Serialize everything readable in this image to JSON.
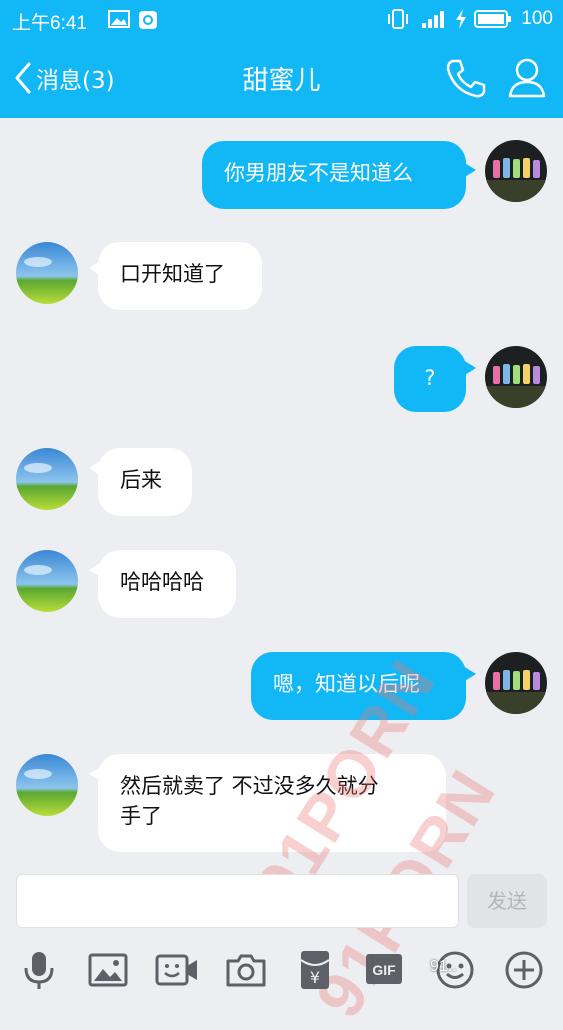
{
  "status_bar": {
    "time": "上午6:41",
    "battery": "100"
  },
  "header": {
    "back_label": "消息(3)",
    "title": "甜蜜儿"
  },
  "messages": [
    {
      "side": "out",
      "text": "你男朋友不是知道么"
    },
    {
      "side": "in",
      "text": "口开知道了"
    },
    {
      "side": "out",
      "text": "?"
    },
    {
      "side": "in",
      "text": "后来"
    },
    {
      "side": "in",
      "text": "哈哈哈哈"
    },
    {
      "side": "out",
      "text": "嗯，知道以后呢"
    },
    {
      "side": "in",
      "text": "然后就卖了 不过没多久就分\n手了"
    }
  ],
  "input": {
    "value": "",
    "send_label": "发送"
  },
  "toolbar": {
    "items": [
      "microphone-icon",
      "image-icon",
      "video-call-icon",
      "camera-icon",
      "red-packet-icon",
      "gif-icon",
      "emoji-icon",
      "plus-icon"
    ],
    "gif_label": "GIF",
    "yen_label": "¥"
  },
  "watermark": {
    "text_1": "91PORN",
    "text_2": "91PORN",
    "site": "91.."
  },
  "colors": {
    "accent": "#12b7f5",
    "background": "#edeef2",
    "bubble_in": "#ffffff"
  }
}
